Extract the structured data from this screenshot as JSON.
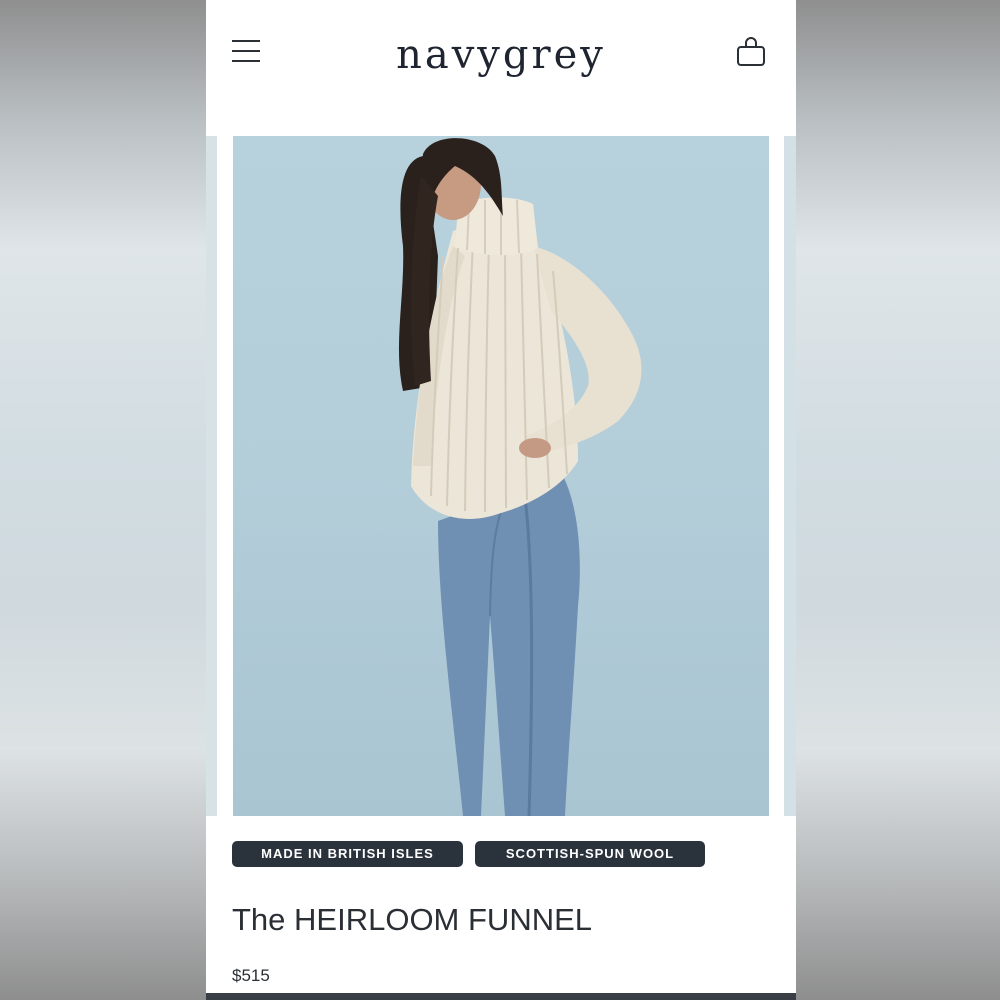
{
  "header": {
    "logo": "navygrey",
    "menu_icon": "hamburger-menu-icon",
    "cart_icon": "shopping-bag-icon"
  },
  "product": {
    "image_alt": "Model wearing a cream ribbed funnel-neck sweater with blue jeans",
    "badges": [
      "MADE IN BRITISH ISLES",
      "SCOTTISH-SPUN WOOL"
    ],
    "title": "The HEIRLOOM FUNNEL",
    "price": "$515"
  },
  "colors": {
    "badge_bg": "#2a323c",
    "text": "#2a2e35",
    "hero_bg": "#b3cdd9"
  }
}
